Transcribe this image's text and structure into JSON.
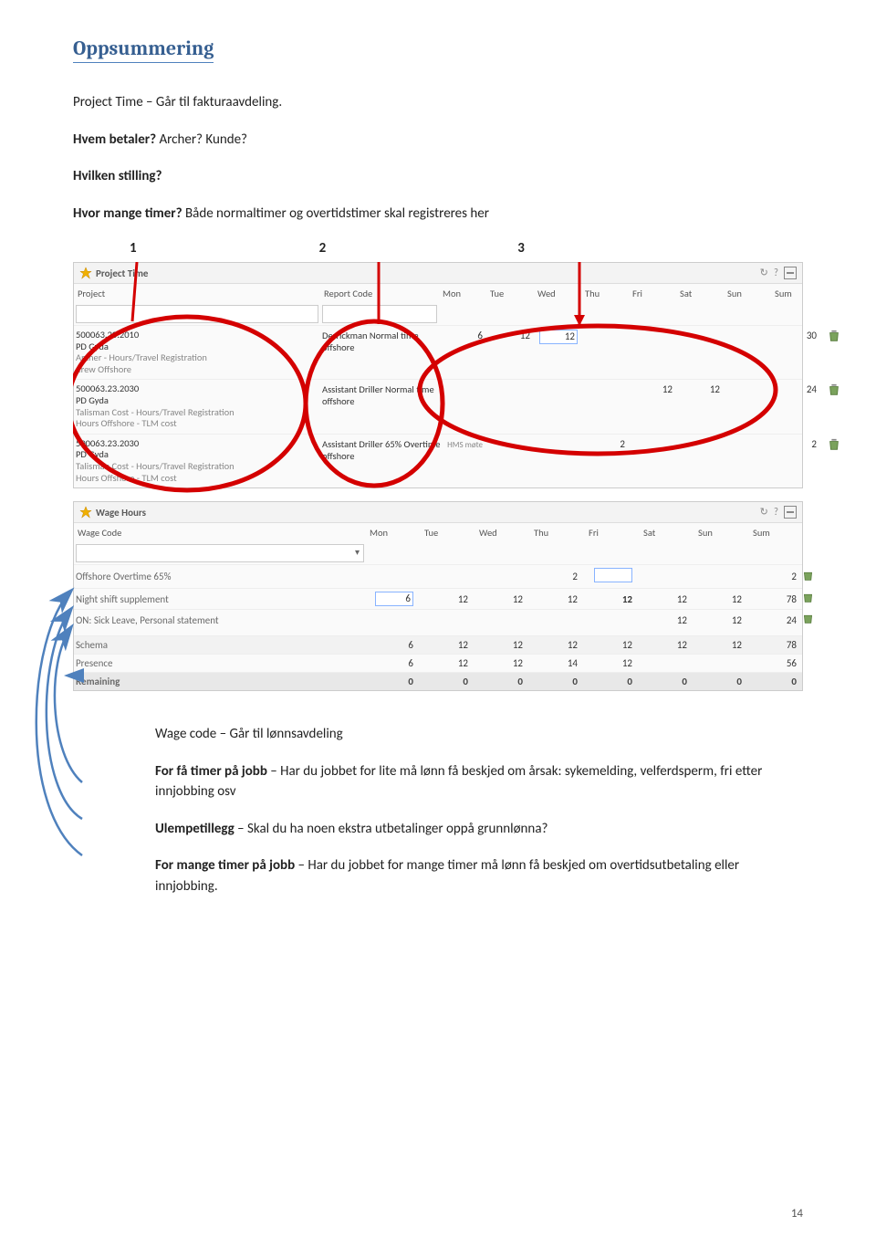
{
  "heading": "Oppsummering",
  "intro": {
    "l1": "Project Time – Går til fakturaavdeling.",
    "l2a": "Hvem betaler?",
    "l2b": " Archer? Kunde?",
    "l3": "Hvilken stilling?",
    "l4a": "Hvor mange timer?",
    "l4b": " Både normaltimer og overtidstimer skal registreres her"
  },
  "numbers": {
    "n1": "1",
    "n2": "2",
    "n3": "3"
  },
  "projectTime": {
    "title": "Project Time",
    "cols": {
      "project": "Project",
      "report": "Report Code",
      "mon": "Mon",
      "tue": "Tue",
      "wed": "Wed",
      "thu": "Thu",
      "fri": "Fri",
      "sat": "Sat",
      "sun": "Sun",
      "sum": "Sum"
    },
    "rows": [
      {
        "id": "500063.20.2010",
        "name": "PD Gyda",
        "cust": "Archer - Hours/Travel Registration",
        "cust2": "Crew Offshore",
        "rc": "Derrickman Normal time offshore",
        "mon": "6",
        "tue": "12",
        "wed": "12",
        "thu": "",
        "fri": "",
        "sat": "",
        "sun": "",
        "sum": "30"
      },
      {
        "id": "500063.23.2030",
        "name": "PD Gyda",
        "cust": "Talisman Cost - Hours/Travel Registration",
        "cust2": "Hours Offshore - TLM cost",
        "rc": "Assistant Driller Normal time offshore",
        "mon": "",
        "tue": "",
        "wed": "",
        "thu": "",
        "fri": "12",
        "sat": "12",
        "sun": "",
        "sum": "24"
      },
      {
        "id": "500063.23.2030",
        "name": "PD Gyda",
        "cust": "Talisman Cost - Hours/Travel Registration",
        "cust2": "Hours Offshore - TLM cost",
        "rc": "Assistant Driller 65% Overtime offshore",
        "mon": "",
        "tue": "",
        "wed": "",
        "thu": "2",
        "fri": "",
        "sat": "",
        "sun": "",
        "sum": "2",
        "note": "HMS møte"
      }
    ]
  },
  "wageHours": {
    "title": "Wage Hours",
    "cols": {
      "wc": "Wage Code",
      "mon": "Mon",
      "tue": "Tue",
      "wed": "Wed",
      "thu": "Thu",
      "fri": "Fri",
      "sat": "Sat",
      "sun": "Sun",
      "sum": "Sum"
    },
    "rows": [
      {
        "label": "Offshore Overtime 65%",
        "mon": "",
        "tue": "",
        "wed": "",
        "thu": "2",
        "fri": "",
        "sat": "",
        "sun": "",
        "sum": "2"
      },
      {
        "label": "Night shift supplement",
        "mon": "6",
        "tue": "12",
        "wed": "12",
        "thu": "12",
        "fri": "12",
        "sat": "12",
        "sun": "12",
        "sum": "78"
      },
      {
        "label": "ON: Sick Leave, Personal statement",
        "mon": "",
        "tue": "",
        "wed": "",
        "thu": "",
        "fri": "",
        "sat": "12",
        "sun": "12",
        "sum": "24"
      }
    ],
    "schema": {
      "label": "Schema",
      "mon": "6",
      "tue": "12",
      "wed": "12",
      "thu": "12",
      "fri": "12",
      "sat": "12",
      "sun": "12",
      "sum": "78"
    },
    "presence": {
      "label": "Presence",
      "mon": "6",
      "tue": "12",
      "wed": "12",
      "thu": "14",
      "fri": "12",
      "sat": "",
      "sun": "",
      "sum": "56"
    },
    "remaining": {
      "label": "Remaining",
      "mon": "0",
      "tue": "0",
      "wed": "0",
      "thu": "0",
      "fri": "0",
      "sat": "0",
      "sun": "0",
      "sum": "0"
    }
  },
  "body": {
    "p1": "Wage code – Går til lønnsavdeling",
    "p2a": "For få timer på jobb",
    "p2b": " – Har du jobbet for lite må lønn få beskjed om årsak: sykemelding, velferdsperm, fri etter innjobbing osv",
    "p3a": "Ulempetillegg",
    "p3b": " – Skal du ha noen ekstra utbetalinger oppå grunnlønna?",
    "p4a": "For mange timer på jobb",
    "p4b": " – Har du jobbet for mange timer må lønn få beskjed om overtidsutbetaling eller innjobbing."
  },
  "page": "14"
}
